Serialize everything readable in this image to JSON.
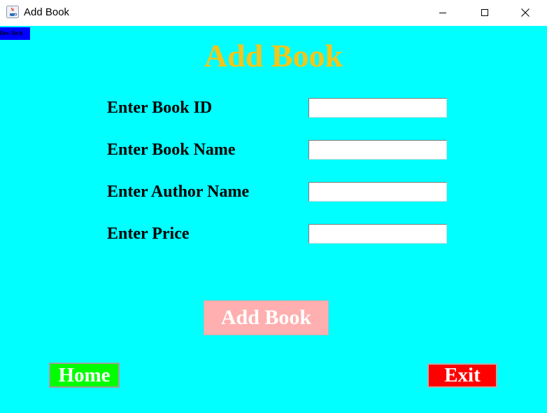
{
  "window": {
    "title": "Add Book"
  },
  "branding": {
    "tag": "Dev-Tech"
  },
  "form": {
    "heading": "Add Book",
    "fields": [
      {
        "label": "Enter Book ID",
        "value": ""
      },
      {
        "label": "Enter Book Name",
        "value": ""
      },
      {
        "label": "Enter Author Name",
        "value": ""
      },
      {
        "label": "Enter Price",
        "value": ""
      }
    ],
    "submit_label": "Add Book"
  },
  "nav": {
    "home_label": "Home",
    "exit_label": "Exit"
  },
  "colors": {
    "background": "#00ffff",
    "heading": "#f5c518",
    "add_button": "#ffafaf",
    "home_button": "#00ff00",
    "exit_button": "#ff0000",
    "tag_background": "#0000ff"
  }
}
